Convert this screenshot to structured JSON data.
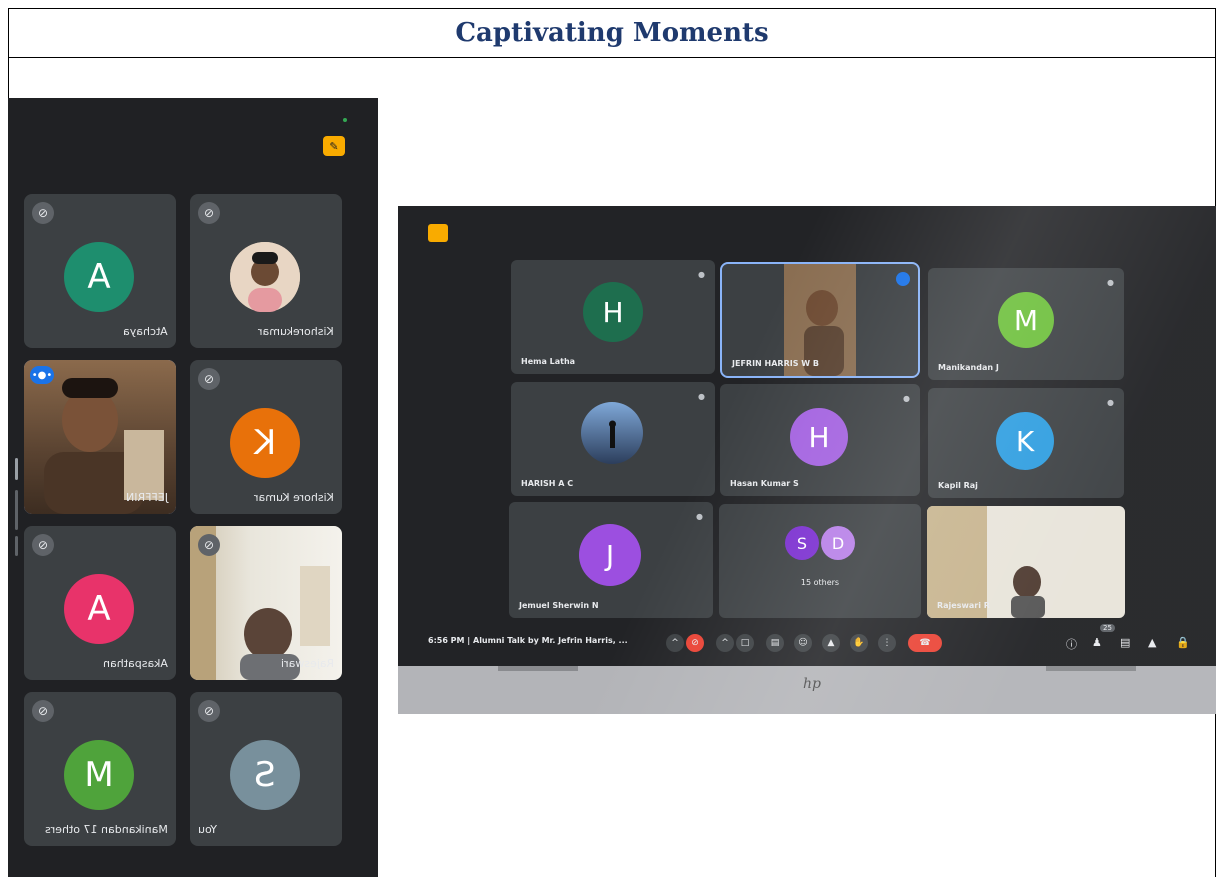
{
  "title": "Captivating Moments",
  "phone": {
    "tiles": [
      {
        "name": "Atchaya",
        "initial": "A",
        "color": "#1e8e6e"
      },
      {
        "name": "Kishorekumar",
        "initial": "",
        "color": ""
      },
      {
        "name": "JEFFRIN",
        "initial": "",
        "color": ""
      },
      {
        "name": "Kishore Kumar",
        "initial": "K",
        "color": "#e8710a"
      },
      {
        "name": "Akaspathan",
        "initial": "A",
        "color": "#e8336a"
      },
      {
        "name": "Rajeswari",
        "initial": "",
        "color": ""
      },
      {
        "name": "Manikandan",
        "others": "17 others",
        "initial": "M",
        "color": "#4fa33b"
      },
      {
        "name": "You",
        "initial": "S",
        "color": "#78909c"
      }
    ]
  },
  "laptop": {
    "tiles": [
      {
        "name": "Hema Latha",
        "initial": "H",
        "color": "#1e6e4e"
      },
      {
        "name": "JEFRIN HARRIS W B",
        "initial": "",
        "color": ""
      },
      {
        "name": "Manikandan J",
        "initial": "M",
        "color": "#6cbf3a"
      },
      {
        "name": "HARISH A C",
        "initial": "",
        "color": ""
      },
      {
        "name": "Hasan Kumar S",
        "initial": "H",
        "color": "#a463e0"
      },
      {
        "name": "Kapil Raj",
        "initial": "K",
        "color": "#2d9de0"
      },
      {
        "name": "Jemuel Sherwin N",
        "initial": "J",
        "color": "#9c4fe0"
      },
      {
        "name": "15 others",
        "initial_a": "S",
        "initial_b": "D",
        "color_a": "#7b2fd0",
        "color_b": "#b77fe8"
      },
      {
        "name": "Rajeswari R",
        "initial": "",
        "color": ""
      }
    ],
    "meeting_info": "6:56 PM  |  Alumni Talk by Mr. Jefrin Harris, ...",
    "participants_count": "25",
    "brand": "hp"
  }
}
